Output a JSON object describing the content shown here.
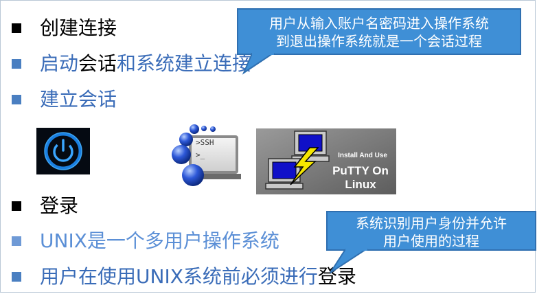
{
  "bullets": [
    {
      "icon": "square-black-bullet",
      "parts": [
        {
          "text": "创建连接",
          "color": "black"
        }
      ]
    },
    {
      "icon": "square-blue-bullet",
      "parts": [
        {
          "text": "启动",
          "color": "blue"
        },
        {
          "text": "会话",
          "color": "black"
        },
        {
          "text": "和系统建立连接",
          "color": "blue"
        }
      ]
    },
    {
      "icon": "square-blue-bullet",
      "parts": [
        {
          "text": "建立会话",
          "color": "blue"
        }
      ]
    },
    {
      "icon": "square-black-bullet",
      "parts": [
        {
          "text": "登录",
          "color": "black"
        }
      ]
    },
    {
      "icon": "square-blue-bullet",
      "parts": [
        {
          "text": "UNIX是一个多用户操作系统",
          "color": "ltblue"
        }
      ]
    },
    {
      "icon": "square-blue-bullet",
      "parts": [
        {
          "text": "用户在使用UNIX系统前必须进行",
          "color": "blue"
        },
        {
          "text": "登录",
          "color": "black"
        }
      ]
    }
  ],
  "callout_session": {
    "line1": "用户从输入账户名密码进入操作系统",
    "line2": "到退出操作系统就是一个会话过程"
  },
  "callout_login": {
    "line1": "系统识别用户身份并允许",
    "line2": "用户使用的过程"
  },
  "images": {
    "power": "power-button-icon",
    "ssh": {
      "label1": ">SSH",
      "label2": ">_"
    },
    "putty": {
      "line1": "Install And Use",
      "line2": "PuTTY On Linux"
    }
  },
  "colors": {
    "accent": "#3a6cb8",
    "callout": "#3f8fd6",
    "callout_border": "#2f6fb0"
  }
}
